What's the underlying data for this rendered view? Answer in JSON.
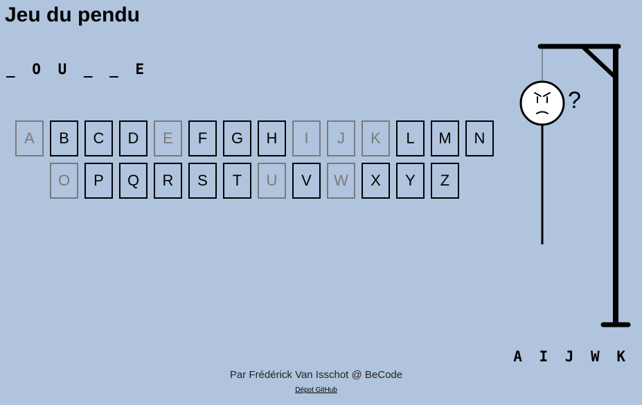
{
  "title": "Jeu du pendu",
  "word_display": "_ O U _ _ E",
  "keyboard": {
    "row1": [
      {
        "letter": "A",
        "used": true
      },
      {
        "letter": "B",
        "used": false
      },
      {
        "letter": "C",
        "used": false
      },
      {
        "letter": "D",
        "used": false
      },
      {
        "letter": "E",
        "used": true
      },
      {
        "letter": "F",
        "used": false
      },
      {
        "letter": "G",
        "used": false
      },
      {
        "letter": "H",
        "used": false
      },
      {
        "letter": "I",
        "used": true
      },
      {
        "letter": "J",
        "used": true
      },
      {
        "letter": "K",
        "used": true
      },
      {
        "letter": "L",
        "used": false
      },
      {
        "letter": "M",
        "used": false
      },
      {
        "letter": "N",
        "used": false
      }
    ],
    "row2": [
      {
        "letter": "O",
        "used": true
      },
      {
        "letter": "P",
        "used": false
      },
      {
        "letter": "Q",
        "used": false
      },
      {
        "letter": "R",
        "used": false
      },
      {
        "letter": "S",
        "used": false
      },
      {
        "letter": "T",
        "used": false
      },
      {
        "letter": "U",
        "used": true
      },
      {
        "letter": "V",
        "used": false
      },
      {
        "letter": "W",
        "used": true
      },
      {
        "letter": "X",
        "used": false
      },
      {
        "letter": "Y",
        "used": false
      },
      {
        "letter": "Z",
        "used": false
      }
    ]
  },
  "wrong_letters": "A I J W K",
  "hangman": {
    "face_mark": "?",
    "stage_visible": [
      "gallows",
      "rope",
      "head",
      "body"
    ]
  },
  "footer": {
    "credit": "Par Frédérick Van Isschot @ BeCode",
    "link_label": "Dépot GitHub"
  },
  "colors": {
    "background": "#b0c4de",
    "used_key": "#7a7a7a"
  }
}
